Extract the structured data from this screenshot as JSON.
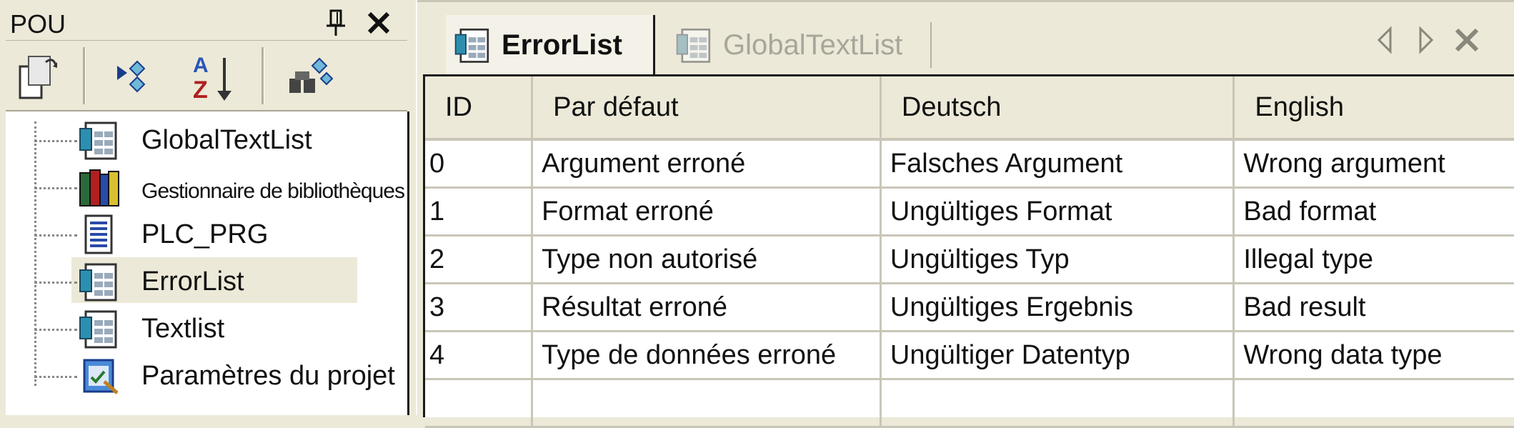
{
  "pou_panel": {
    "title": "POU",
    "toolbar": {
      "icons": [
        "properties-icon",
        "sort-by-type-icon",
        "sort-az-icon",
        "find-icon"
      ]
    },
    "tree": [
      {
        "label": "GlobalTextList",
        "icon": "textlist-icon"
      },
      {
        "label": "Gestionnaire de bibliothèques",
        "icon": "library-manager-icon"
      },
      {
        "label": "PLC_PRG",
        "icon": "program-icon"
      },
      {
        "label": "ErrorList",
        "icon": "textlist-icon",
        "selected": true
      },
      {
        "label": "Textlist",
        "icon": "textlist-icon"
      },
      {
        "label": "Paramètres du projet",
        "icon": "project-settings-icon"
      }
    ]
  },
  "editor": {
    "tabs": [
      {
        "label": "ErrorList",
        "active": true
      },
      {
        "label": "GlobalTextList",
        "active": false
      }
    ],
    "table": {
      "columns": [
        "ID",
        "Par défaut",
        "Deutsch",
        "English"
      ],
      "rows": [
        [
          "0",
          "Argument erroné",
          "Falsches Argument",
          "Wrong argument"
        ],
        [
          "1",
          "Format erroné",
          "Ungültiges Format",
          "Bad format"
        ],
        [
          "2",
          "Type non autorisé",
          "Ungültiges Typ",
          "Illegal type"
        ],
        [
          "3",
          "Résultat erroné",
          "Ungültiges Ergebnis",
          "Bad result"
        ],
        [
          "4",
          "Type de données erroné",
          "Ungültiger Datentyp",
          "Wrong data type"
        ],
        [
          "",
          "",
          "",
          ""
        ]
      ]
    }
  },
  "colors": {
    "panel_bg": "#ece9d8",
    "grid_line": "#c9c6b8",
    "inactive_tab_text": "#a8a69a"
  }
}
